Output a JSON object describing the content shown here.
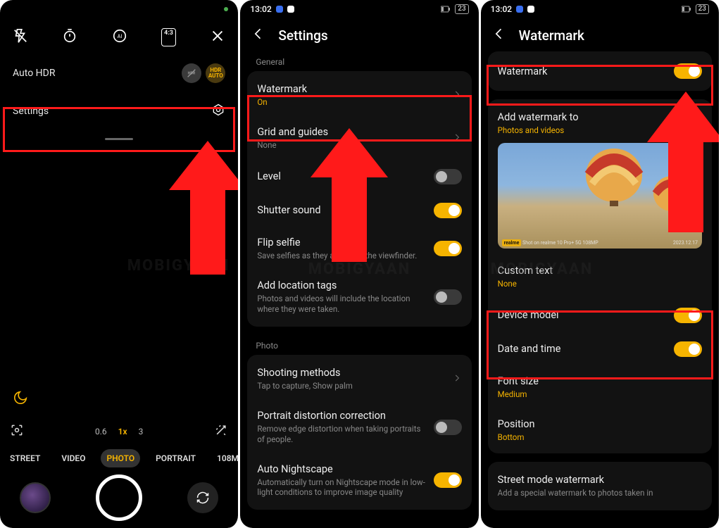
{
  "status": {
    "time": "13:02",
    "battery": "23"
  },
  "panel1": {
    "auto_hdr": "Auto HDR",
    "hdr_auto": "HDR\nAUTO",
    "settings": "Settings",
    "zooms": [
      "0.6",
      "1x",
      "3"
    ],
    "modes": {
      "street": "STREET",
      "video": "VIDEO",
      "photo": "PHOTO",
      "portrait": "PORTRAIT",
      "high": "108M"
    },
    "ratio": "4:3"
  },
  "panel2": {
    "title": "Settings",
    "section_general": "General",
    "watermark": {
      "title": "Watermark",
      "sub": "On"
    },
    "grid": {
      "title": "Grid and guides",
      "sub": "None"
    },
    "level": "Level",
    "shutter": "Shutter sound",
    "flip": {
      "title": "Flip selfie",
      "sub": "Save selfies as they appear in the viewfinder."
    },
    "location": {
      "title": "Add location tags",
      "sub": "Photos and videos will include the location where they were taken."
    },
    "section_photo": "Photo",
    "shooting": {
      "title": "Shooting methods",
      "sub": "Tap to capture, Show palm"
    },
    "distortion": {
      "title": "Portrait distortion correction",
      "sub": "Remove edge distortion when taking portraits of people."
    },
    "nightscape": {
      "title": "Auto Nightscape",
      "sub": "Automatically turn on Nightscape mode in low-light conditions to improve image quality"
    }
  },
  "panel3": {
    "title": "Watermark",
    "watermark_toggle": "Watermark",
    "addto": {
      "title": "Add watermark to",
      "sub": "Photos and videos"
    },
    "preview_wm_left": "Shot on realme 10 Pro+ 5G 108MP",
    "custom": {
      "title": "Custom text",
      "sub": "None"
    },
    "device": "Device model",
    "datetime": "Date and time",
    "font": {
      "title": "Font size",
      "sub": "Medium"
    },
    "position": {
      "title": "Position",
      "sub": "Bottom"
    },
    "street": {
      "title": "Street mode watermark",
      "sub": "Add a special watermark to photos taken in"
    }
  },
  "bg_watermark": "MOBIGYAAN"
}
